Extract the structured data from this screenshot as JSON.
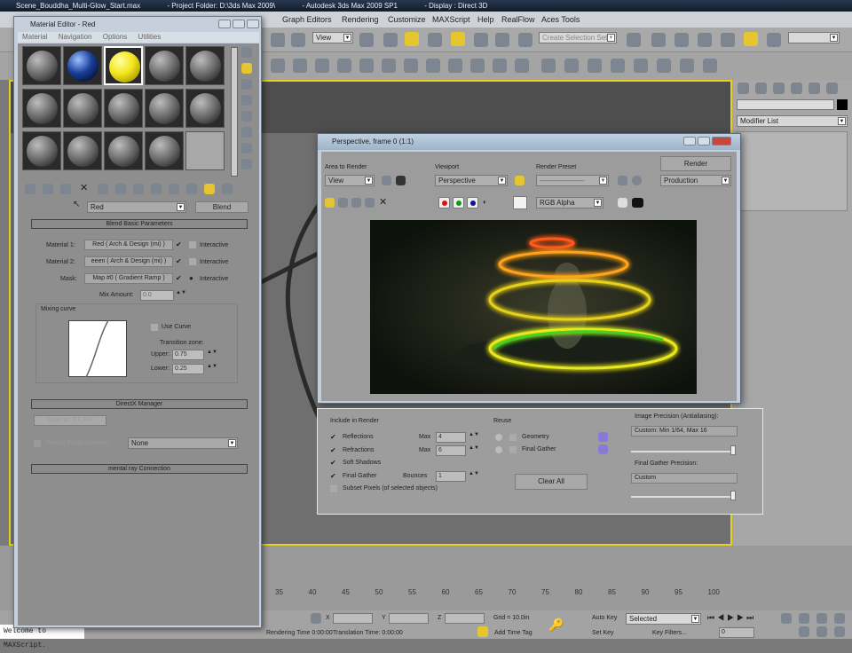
{
  "titlebar": {
    "scene": "Scene_Bouddha_Multi-Glow_Start.max",
    "project": "- Project Folder: D:\\3ds Max 2009\\",
    "app": "- Autodesk 3ds Max 2009 SP1",
    "display": "- Display : Direct 3D"
  },
  "menubar": {
    "items": [
      "Graph Editors",
      "Rendering",
      "Customize",
      "MAXScript",
      "Help",
      "RealFlow",
      "Aces Tools"
    ]
  },
  "toolbar": {
    "reference_coord": "View",
    "named_selection": "Create Selection Set"
  },
  "command_panel": {
    "modifier_list": "Modifier List"
  },
  "material_editor": {
    "title": "Material Editor - Red",
    "menu": [
      "Material",
      "Navigation",
      "Options",
      "Utilities"
    ],
    "material_name": "Red",
    "material_type": "Blend",
    "blend_rollout": "Blend Basic Parameters",
    "rows": [
      {
        "label": "Material 1:",
        "value": "Red ( Arch & Design (mi) )",
        "interactive": "Interactive"
      },
      {
        "label": "Material 2:",
        "value": "eeen ( Arch & Design (mi) )",
        "interactive": "Interactive"
      },
      {
        "label": "Mask:",
        "value": "Map #0 ( Gradient Ramp )",
        "interactive": "Interactive"
      }
    ],
    "mix_amount_label": "Mix Amount:",
    "mix_amount": "0.0",
    "mixing_curve": "Mixing curve",
    "use_curve": "Use Curve",
    "transition_zone": "Transition zone:",
    "upper_label": "Upper:",
    "upper": "0.75",
    "lower_label": "Lower:",
    "lower": "0.25",
    "directx_rollout": "DirectX Manager",
    "save_fx": "Save as .FX File",
    "enable_plugin": "Enable Plugin Material",
    "plugin_value": "None",
    "mental_ray_rollout": "mental ray Connection"
  },
  "render_frame": {
    "title": "Perspective, frame 0 (1:1)",
    "area_label": "Area to Render",
    "area_value": "View",
    "viewport_label": "Viewport",
    "viewport_value": "Perspective",
    "preset_label": "Render Preset",
    "preset_value": "-------------------",
    "render_button": "Render",
    "render_mode": "Production",
    "channel": "RGB Alpha"
  },
  "render_settings": {
    "include_label": "Include in Render",
    "items": [
      {
        "label": "Reflections",
        "checked": true,
        "param": "Max",
        "value": "4"
      },
      {
        "label": "Refractions",
        "checked": true,
        "param": "Max",
        "value": "6"
      },
      {
        "label": "Soft Shadows",
        "checked": true
      },
      {
        "label": "Final Gather",
        "checked": true,
        "param": "Bounces",
        "value": "1"
      },
      {
        "label": "Subset Pixels (of selected objects)",
        "checked": false
      }
    ],
    "reuse_label": "Reuse",
    "reuse_geometry": "Geometry",
    "reuse_fg": "Final Gather",
    "clear_all": "Clear All",
    "image_precision_label": "Image Precision (Antialiasing):",
    "image_precision": "Custom: Min 1/64, Max 16",
    "fg_precision_label": "Final Gather Precision:",
    "fg_precision": "Custom"
  },
  "timeline": {
    "ticks": [
      "35",
      "40",
      "45",
      "50",
      "55",
      "60",
      "65",
      "70",
      "75",
      "80",
      "85",
      "90",
      "95",
      "100"
    ]
  },
  "status": {
    "maxscript": "Welcome to MAXScript.",
    "rendering_time": "Rendering Time 0:00:00",
    "translation_time": "Translation Time: 0:00:00",
    "x_label": "X",
    "y_label": "Y",
    "z_label": "Z",
    "grid": "Grid = 10.0in",
    "add_time_tag": "Add Time Tag",
    "auto_key": "Auto Key",
    "auto_key_mode": "Selected",
    "set_key": "Set Key",
    "key_filters": "Key Filters...",
    "frame": "0"
  },
  "colors": {
    "active_viewport": "#e5d21f",
    "accent_yellow": "#e6c62e"
  }
}
